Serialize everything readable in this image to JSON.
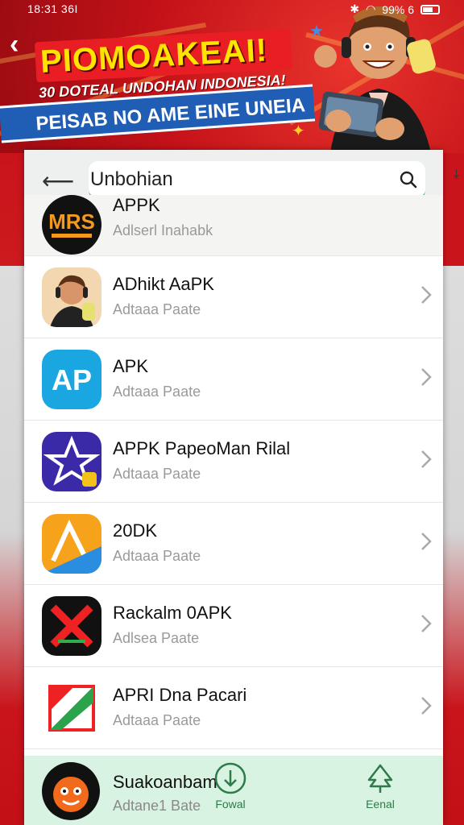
{
  "status_bar": {
    "time": "18:31 36I",
    "battery": "99% 6"
  },
  "banner": {
    "title": "PIOMOAKEAI!",
    "subtitle": "30 DOTEAL UNDOHAN INDONESIA!",
    "strip_text": "PEISAB NO AME EINE UNEIA"
  },
  "search": {
    "value": "Unbohian",
    "placeholder": ""
  },
  "apps": [
    {
      "name": "APPK",
      "sub": "Adlserl Inahabk",
      "icon": "mrs-logo-icon"
    },
    {
      "name": "ADhikt AaPK",
      "sub": "Adtaaa Paate",
      "icon": "mascot-avatar-icon"
    },
    {
      "name": "APK",
      "sub": "Adtaaa Paate",
      "icon": "ap-logo-icon"
    },
    {
      "name": "APPK PapeoMan Rilal",
      "sub": "Adtaaa Paate",
      "icon": "star-logo-icon"
    },
    {
      "name": "20DK",
      "sub": "Adtaaa Paate",
      "icon": "arrow-logo-icon"
    },
    {
      "name": "Rackalm 0APK",
      "sub": "Adlsea Paate",
      "icon": "x-logo-icon"
    },
    {
      "name": "APRI Dna Pacari",
      "sub": "Adtaaa Paate",
      "icon": "flag-logo-icon"
    }
  ],
  "bottom_bar": {
    "app_name": "Suakoanbam",
    "app_sub": "Adtane1 Bate",
    "app_icon": "monkey-face-icon",
    "nav": [
      {
        "label": "Fowal",
        "icon": "download-circle-icon"
      },
      {
        "label": "Eenal",
        "icon": "tree-icon"
      }
    ]
  },
  "colors": {
    "accent_green": "#2a9d4a",
    "banner_red": "#c9141b",
    "banner_blue": "#1f5eb4",
    "banner_yellow": "#ffe400"
  }
}
